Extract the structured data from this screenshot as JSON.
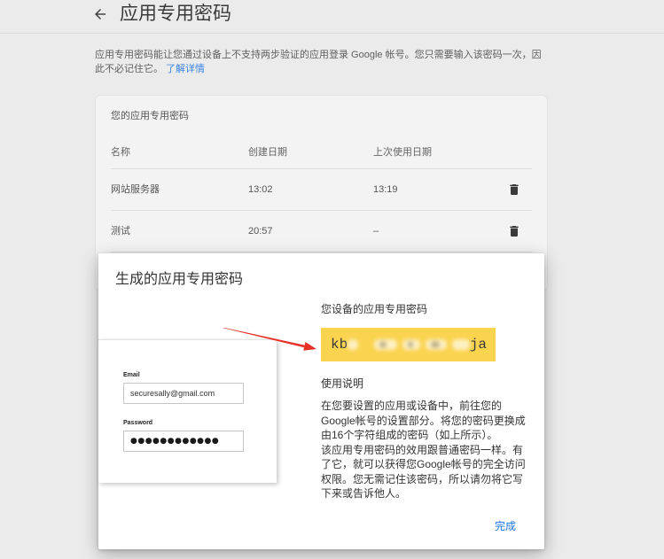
{
  "header": {
    "back_icon": "arrow-left-icon",
    "title": "应用专用密码"
  },
  "intro": {
    "text": "应用专用密码能让您通过设备上不支持两步验证的应用登录 Google 帐号。您只需要输入该密码一次，因此不必记住它。",
    "learn_more": "了解详情"
  },
  "card": {
    "title": "您的应用专用密码",
    "columns": [
      "名称",
      "创建日期",
      "上次使用日期"
    ],
    "rows": [
      {
        "name": "网站服务器",
        "created": "13:02",
        "last_used": "13:19",
        "action_icon": "trash-icon"
      },
      {
        "name": "测试",
        "created": "20:57",
        "last_used": "–",
        "action_icon": "trash-icon"
      }
    ]
  },
  "dialog": {
    "title": "生成的应用专用密码",
    "illustration": {
      "email_label": "Email",
      "email_value": "securesally@gmail.com",
      "password_label": "Password",
      "password_mask": "●●●●●●●●●●●●"
    },
    "password_heading": "您设备的应用专用密码",
    "password_visible_start": "kb",
    "password_visible_end": "ja",
    "instructions_heading": "使用说明",
    "instructions_lines": [
      "在您要设置的应用或设备中，前往您的",
      "Google帐号的设置部分。将您的密码更换成",
      "由16个字符组成的密码（如上所示）。",
      "该应用专用密码的效用跟普通密码一样。有",
      "了它，就可以获得您Google帐号的完全访问",
      "权限。您无需记住该密码，所以请勿将它写",
      "下来或告诉他人。"
    ],
    "done_label": "完成"
  },
  "colors": {
    "accent": "#1a73e8",
    "annotation_arrow": "#e53127",
    "password_highlight": "#fad34f"
  }
}
